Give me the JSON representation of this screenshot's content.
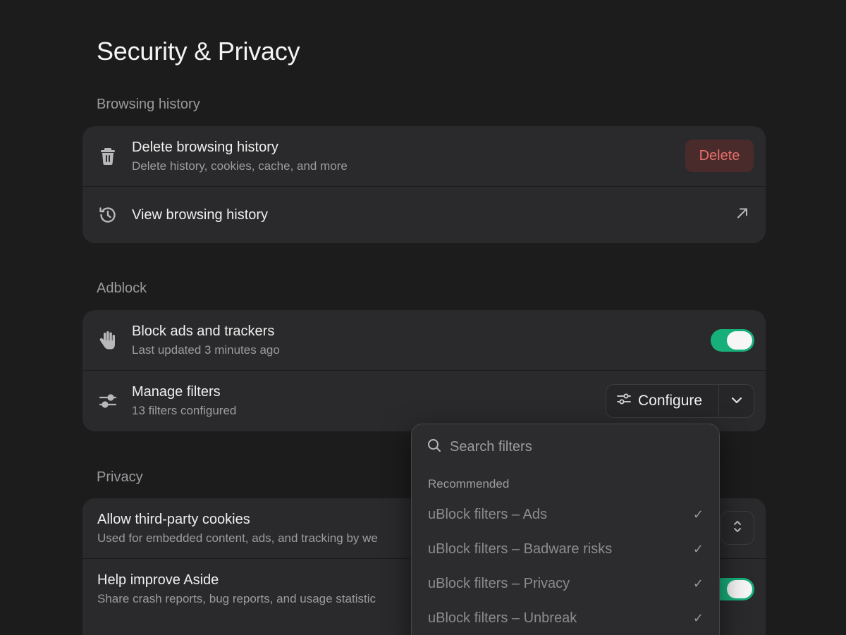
{
  "page": {
    "title": "Security & Privacy"
  },
  "browsing_history": {
    "section_label": "Browsing history",
    "delete": {
      "title": "Delete browsing history",
      "subtitle": "Delete history, cookies, cache, and more",
      "button_label": "Delete",
      "icon": "trash-icon"
    },
    "view": {
      "title": "View browsing history",
      "icon": "history-icon",
      "action_icon": "arrow-up-right-icon"
    }
  },
  "adblock": {
    "section_label": "Adblock",
    "block": {
      "title": "Block ads and trackers",
      "subtitle": "Last updated 3 minutes ago",
      "icon": "hand-icon",
      "enabled": true
    },
    "filters": {
      "title": "Manage filters",
      "subtitle": "13 filters configured",
      "icon": "sliders-icon",
      "configure_label": "Configure"
    }
  },
  "privacy": {
    "section_label": "Privacy",
    "cookies": {
      "title": "Allow third-party cookies",
      "subtitle": "Used for embedded content, ads, and tracking by we"
    },
    "improve": {
      "title": "Help improve Aside",
      "subtitle": "Share crash reports, bug reports, and usage statistic",
      "enabled": true
    }
  },
  "filter_menu": {
    "search_placeholder": "Search filters",
    "group_label": "Recommended",
    "items": [
      {
        "label": "uBlock filters – Ads",
        "checked": true
      },
      {
        "label": "uBlock filters – Badware risks",
        "checked": true
      },
      {
        "label": "uBlock filters – Privacy",
        "checked": true
      },
      {
        "label": "uBlock filters – Unbreak",
        "checked": true
      }
    ],
    "check_glyph": "✓"
  },
  "colors": {
    "background": "#1c1c1d",
    "card": "#2a2a2c",
    "toggle_on": "#17b07a",
    "danger_text": "#e86f6a",
    "danger_bg": "#4a2b2b"
  }
}
